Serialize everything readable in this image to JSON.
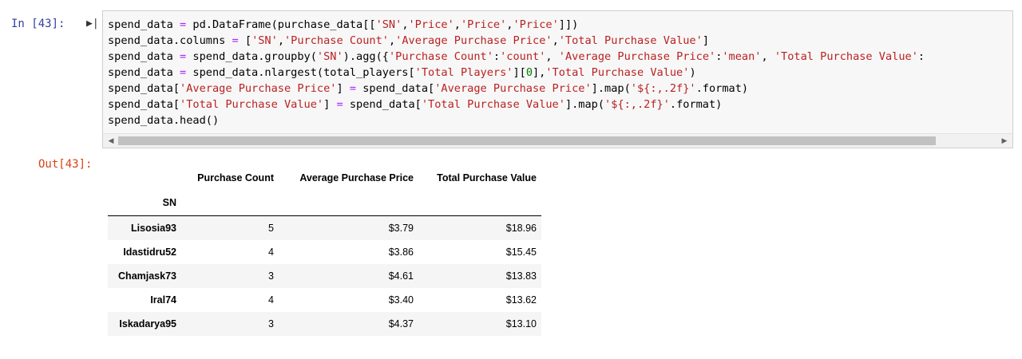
{
  "cell": {
    "in_prompt": "In [43]:",
    "out_prompt": "Out[43]:",
    "run_marker": "▶|"
  },
  "code_lines": [
    [
      {
        "t": "spend_data ",
        "c": ""
      },
      {
        "t": "=",
        "c": "o"
      },
      {
        "t": " pd.DataFrame(purchase_data[[",
        "c": ""
      },
      {
        "t": "'SN'",
        "c": "s"
      },
      {
        "t": ",",
        "c": ""
      },
      {
        "t": "'Price'",
        "c": "s"
      },
      {
        "t": ",",
        "c": ""
      },
      {
        "t": "'Price'",
        "c": "s"
      },
      {
        "t": ",",
        "c": ""
      },
      {
        "t": "'Price'",
        "c": "s"
      },
      {
        "t": "]])",
        "c": ""
      }
    ],
    [
      {
        "t": "spend_data.columns ",
        "c": ""
      },
      {
        "t": "=",
        "c": "o"
      },
      {
        "t": " [",
        "c": ""
      },
      {
        "t": "'SN'",
        "c": "s"
      },
      {
        "t": ",",
        "c": ""
      },
      {
        "t": "'Purchase Count'",
        "c": "s"
      },
      {
        "t": ",",
        "c": ""
      },
      {
        "t": "'Average Purchase Price'",
        "c": "s"
      },
      {
        "t": ",",
        "c": ""
      },
      {
        "t": "'Total Purchase Value'",
        "c": "s"
      },
      {
        "t": "]",
        "c": ""
      }
    ],
    [
      {
        "t": "spend_data ",
        "c": ""
      },
      {
        "t": "=",
        "c": "o"
      },
      {
        "t": " spend_data.groupby(",
        "c": ""
      },
      {
        "t": "'SN'",
        "c": "s"
      },
      {
        "t": ").agg({",
        "c": ""
      },
      {
        "t": "'Purchase Count'",
        "c": "s"
      },
      {
        "t": ":",
        "c": ""
      },
      {
        "t": "'count'",
        "c": "s"
      },
      {
        "t": ", ",
        "c": ""
      },
      {
        "t": "'Average Purchase Price'",
        "c": "s"
      },
      {
        "t": ":",
        "c": ""
      },
      {
        "t": "'mean'",
        "c": "s"
      },
      {
        "t": ", ",
        "c": ""
      },
      {
        "t": "'Total Purchase Value'",
        "c": "s"
      },
      {
        "t": ":",
        "c": ""
      }
    ],
    [
      {
        "t": "spend_data ",
        "c": ""
      },
      {
        "t": "=",
        "c": "o"
      },
      {
        "t": " spend_data.nlargest(total_players[",
        "c": ""
      },
      {
        "t": "'Total Players'",
        "c": "s"
      },
      {
        "t": "][",
        "c": ""
      },
      {
        "t": "0",
        "c": "n"
      },
      {
        "t": "],",
        "c": ""
      },
      {
        "t": "'Total Purchase Value'",
        "c": "s"
      },
      {
        "t": ")",
        "c": ""
      }
    ],
    [
      {
        "t": "spend_data[",
        "c": ""
      },
      {
        "t": "'Average Purchase Price'",
        "c": "s"
      },
      {
        "t": "] ",
        "c": ""
      },
      {
        "t": "=",
        "c": "o"
      },
      {
        "t": " spend_data[",
        "c": ""
      },
      {
        "t": "'Average Purchase Price'",
        "c": "s"
      },
      {
        "t": "].map(",
        "c": ""
      },
      {
        "t": "'${:,.2f}'",
        "c": "s"
      },
      {
        "t": ".format)",
        "c": ""
      }
    ],
    [
      {
        "t": "spend_data[",
        "c": ""
      },
      {
        "t": "'Total Purchase Value'",
        "c": "s"
      },
      {
        "t": "] ",
        "c": ""
      },
      {
        "t": "=",
        "c": "o"
      },
      {
        "t": " spend_data[",
        "c": ""
      },
      {
        "t": "'Total Purchase Value'",
        "c": "s"
      },
      {
        "t": "].map(",
        "c": ""
      },
      {
        "t": "'${:,.2f}'",
        "c": "s"
      },
      {
        "t": ".format)",
        "c": ""
      }
    ],
    [
      {
        "t": "spend_data.head()",
        "c": ""
      }
    ]
  ],
  "scrollbar": {
    "left_arrow": "◀",
    "right_arrow": "▶",
    "thumb_fraction": 0.93
  },
  "table": {
    "columns": [
      "Purchase Count",
      "Average Purchase Price",
      "Total Purchase Value"
    ],
    "index_name": "SN",
    "rows": [
      {
        "sn": "Lisosia93",
        "count": "5",
        "avg": "$3.79",
        "total": "$18.96"
      },
      {
        "sn": "Idastidru52",
        "count": "4",
        "avg": "$3.86",
        "total": "$15.45"
      },
      {
        "sn": "Chamjask73",
        "count": "3",
        "avg": "$4.61",
        "total": "$13.83"
      },
      {
        "sn": "Iral74",
        "count": "4",
        "avg": "$3.40",
        "total": "$13.62"
      },
      {
        "sn": "Iskadarya95",
        "count": "3",
        "avg": "$4.37",
        "total": "$13.10"
      }
    ]
  },
  "colors": {
    "in_prompt": "#303f9f",
    "out_prompt": "#d84315",
    "string": "#ba2121",
    "operator": "#aa22ff",
    "number": "#008000",
    "cell_bg": "#f7f7f7",
    "row_stripe": "#f5f5f5"
  }
}
